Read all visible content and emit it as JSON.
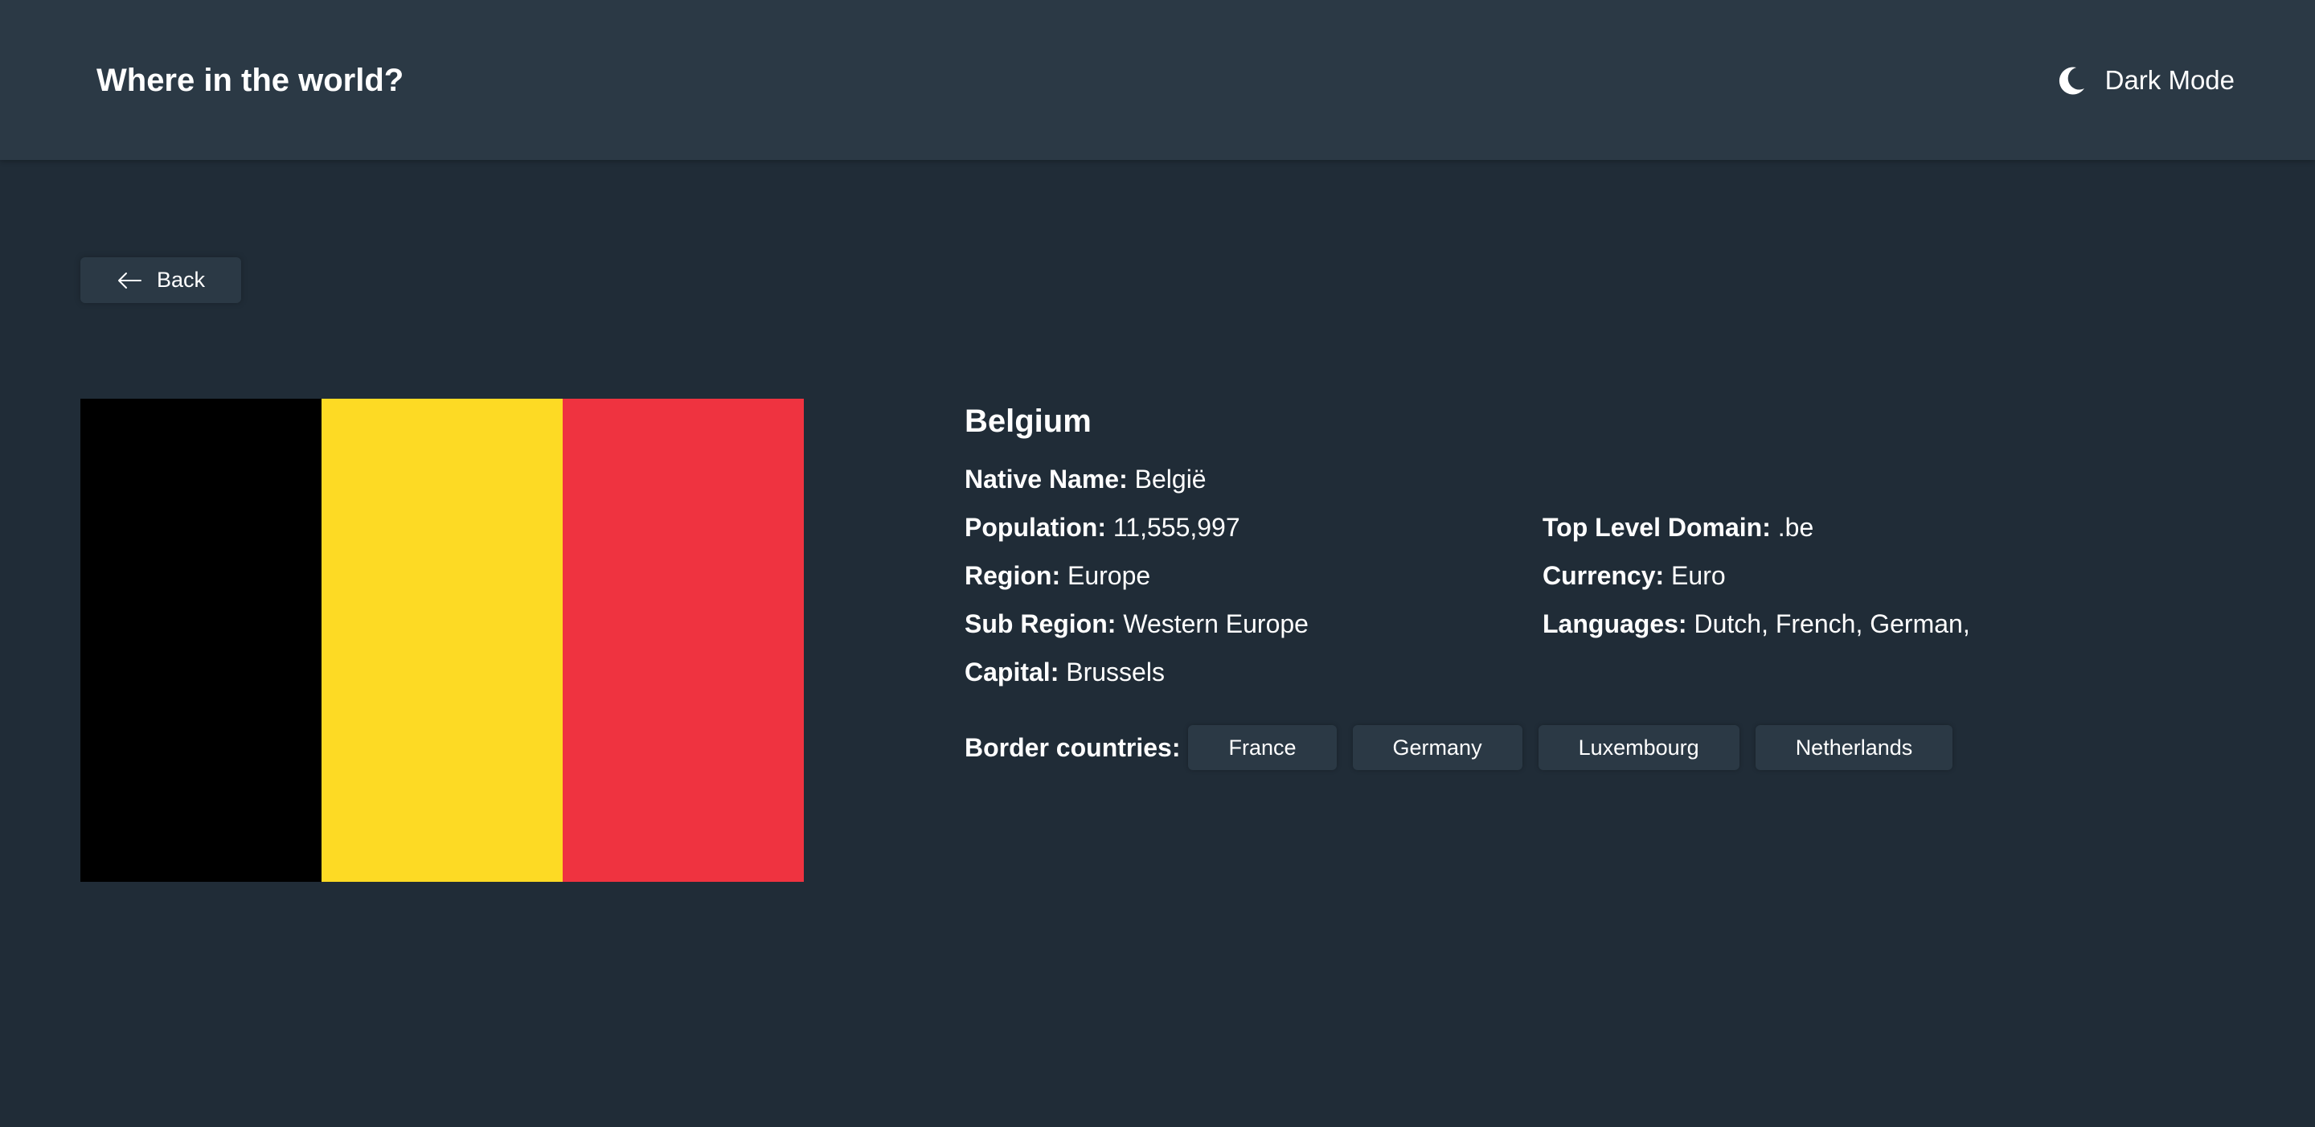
{
  "header": {
    "title": "Where in the world?",
    "theme_toggle_label": "Dark Mode",
    "theme_icon": "moon-icon"
  },
  "back_button": {
    "label": "Back",
    "icon": "arrow-left-icon"
  },
  "country": {
    "name": "Belgium",
    "flag_colors": [
      "#000000",
      "#fdda24",
      "#ef3340"
    ],
    "left_info": [
      {
        "label": "Native Name:",
        "value": "België"
      },
      {
        "label": "Population:",
        "value": "11,555,997"
      },
      {
        "label": "Region:",
        "value": "Europe"
      },
      {
        "label": "Sub Region:",
        "value": "Western Europe"
      },
      {
        "label": "Capital:",
        "value": "Brussels"
      }
    ],
    "right_info": [
      {
        "label": "Top Level Domain:",
        "value": ".be"
      },
      {
        "label": "Currency:",
        "value": "Euro"
      },
      {
        "label": "Languages:",
        "value": "Dutch, French, German,"
      }
    ],
    "border_label": "Border countries:",
    "border_countries": [
      "France",
      "Germany",
      "Luxembourg",
      "Netherlands"
    ]
  },
  "colors": {
    "background": "#202c37",
    "elements": "#2b3945",
    "text": "#ffffff"
  }
}
